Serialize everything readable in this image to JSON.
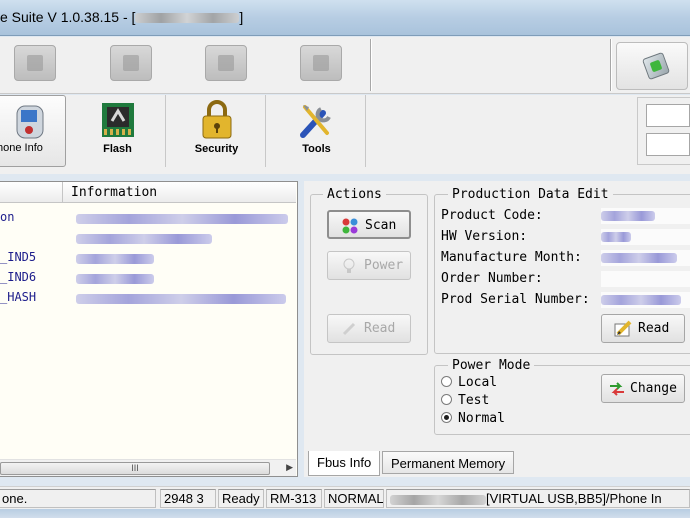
{
  "window": {
    "title_prefix": "e Suite V 1.0.38.15 - [",
    "title_suffix": "]"
  },
  "toolbar_main": {
    "phone_info": "hone Info",
    "flash": "Flash",
    "security": "Security",
    "tools": "Tools"
  },
  "info_list": {
    "column_information": "Information",
    "rows": [
      {
        "name": "on"
      },
      {
        "name": ""
      },
      {
        "name": "_IND5"
      },
      {
        "name": "_IND6"
      },
      {
        "name": "_HASH"
      }
    ],
    "scrollbar_grip": "III"
  },
  "actions": {
    "title": "Actions",
    "scan": "Scan",
    "power": "Power",
    "read": "Read"
  },
  "production": {
    "title": "Production Data Edit",
    "product_code": "Product Code:",
    "hw_version": "HW Version:",
    "manufacture_month": "Manufacture Month:",
    "order_number": "Order Number:",
    "prod_serial_number": "Prod Serial Number:",
    "read": "Read"
  },
  "power_mode": {
    "title": "Power Mode",
    "options": [
      "Local",
      "Test",
      "Normal"
    ],
    "selected": "Normal",
    "change": "Change"
  },
  "tabs": {
    "fbus_info": "Fbus Info",
    "permanent_memory": "Permanent Memory"
  },
  "status": {
    "message": "one.",
    "counter": "2948 3",
    "state": "Ready",
    "model": "RM-313",
    "mode": "NORMAL",
    "connection": "[VIRTUAL USB,BB5]/Phone In"
  },
  "colors": {
    "list_text": "#1e1e8c",
    "list_background": "#fffef6"
  }
}
